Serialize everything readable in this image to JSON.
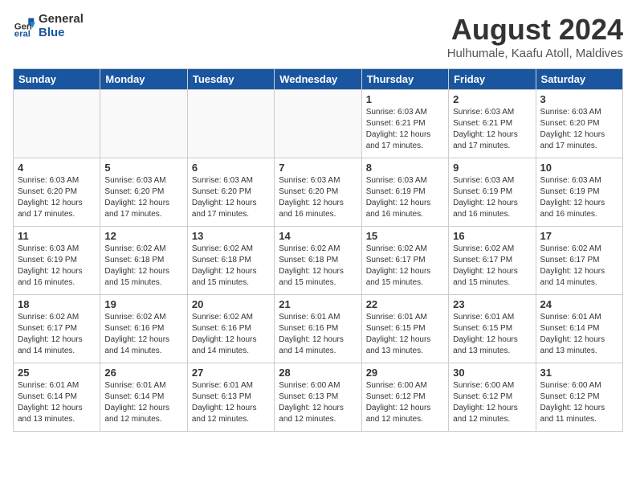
{
  "header": {
    "logo_general": "General",
    "logo_blue": "Blue",
    "month_title": "August 2024",
    "location": "Hulhumale, Kaafu Atoll, Maldives"
  },
  "days_of_week": [
    "Sunday",
    "Monday",
    "Tuesday",
    "Wednesday",
    "Thursday",
    "Friday",
    "Saturday"
  ],
  "weeks": [
    [
      {
        "day": "",
        "info": ""
      },
      {
        "day": "",
        "info": ""
      },
      {
        "day": "",
        "info": ""
      },
      {
        "day": "",
        "info": ""
      },
      {
        "day": "1",
        "info": "Sunrise: 6:03 AM\nSunset: 6:21 PM\nDaylight: 12 hours\nand 17 minutes."
      },
      {
        "day": "2",
        "info": "Sunrise: 6:03 AM\nSunset: 6:21 PM\nDaylight: 12 hours\nand 17 minutes."
      },
      {
        "day": "3",
        "info": "Sunrise: 6:03 AM\nSunset: 6:20 PM\nDaylight: 12 hours\nand 17 minutes."
      }
    ],
    [
      {
        "day": "4",
        "info": "Sunrise: 6:03 AM\nSunset: 6:20 PM\nDaylight: 12 hours\nand 17 minutes."
      },
      {
        "day": "5",
        "info": "Sunrise: 6:03 AM\nSunset: 6:20 PM\nDaylight: 12 hours\nand 17 minutes."
      },
      {
        "day": "6",
        "info": "Sunrise: 6:03 AM\nSunset: 6:20 PM\nDaylight: 12 hours\nand 17 minutes."
      },
      {
        "day": "7",
        "info": "Sunrise: 6:03 AM\nSunset: 6:20 PM\nDaylight: 12 hours\nand 16 minutes."
      },
      {
        "day": "8",
        "info": "Sunrise: 6:03 AM\nSunset: 6:19 PM\nDaylight: 12 hours\nand 16 minutes."
      },
      {
        "day": "9",
        "info": "Sunrise: 6:03 AM\nSunset: 6:19 PM\nDaylight: 12 hours\nand 16 minutes."
      },
      {
        "day": "10",
        "info": "Sunrise: 6:03 AM\nSunset: 6:19 PM\nDaylight: 12 hours\nand 16 minutes."
      }
    ],
    [
      {
        "day": "11",
        "info": "Sunrise: 6:03 AM\nSunset: 6:19 PM\nDaylight: 12 hours\nand 16 minutes."
      },
      {
        "day": "12",
        "info": "Sunrise: 6:02 AM\nSunset: 6:18 PM\nDaylight: 12 hours\nand 15 minutes."
      },
      {
        "day": "13",
        "info": "Sunrise: 6:02 AM\nSunset: 6:18 PM\nDaylight: 12 hours\nand 15 minutes."
      },
      {
        "day": "14",
        "info": "Sunrise: 6:02 AM\nSunset: 6:18 PM\nDaylight: 12 hours\nand 15 minutes."
      },
      {
        "day": "15",
        "info": "Sunrise: 6:02 AM\nSunset: 6:17 PM\nDaylight: 12 hours\nand 15 minutes."
      },
      {
        "day": "16",
        "info": "Sunrise: 6:02 AM\nSunset: 6:17 PM\nDaylight: 12 hours\nand 15 minutes."
      },
      {
        "day": "17",
        "info": "Sunrise: 6:02 AM\nSunset: 6:17 PM\nDaylight: 12 hours\nand 14 minutes."
      }
    ],
    [
      {
        "day": "18",
        "info": "Sunrise: 6:02 AM\nSunset: 6:17 PM\nDaylight: 12 hours\nand 14 minutes."
      },
      {
        "day": "19",
        "info": "Sunrise: 6:02 AM\nSunset: 6:16 PM\nDaylight: 12 hours\nand 14 minutes."
      },
      {
        "day": "20",
        "info": "Sunrise: 6:02 AM\nSunset: 6:16 PM\nDaylight: 12 hours\nand 14 minutes."
      },
      {
        "day": "21",
        "info": "Sunrise: 6:01 AM\nSunset: 6:16 PM\nDaylight: 12 hours\nand 14 minutes."
      },
      {
        "day": "22",
        "info": "Sunrise: 6:01 AM\nSunset: 6:15 PM\nDaylight: 12 hours\nand 13 minutes."
      },
      {
        "day": "23",
        "info": "Sunrise: 6:01 AM\nSunset: 6:15 PM\nDaylight: 12 hours\nand 13 minutes."
      },
      {
        "day": "24",
        "info": "Sunrise: 6:01 AM\nSunset: 6:14 PM\nDaylight: 12 hours\nand 13 minutes."
      }
    ],
    [
      {
        "day": "25",
        "info": "Sunrise: 6:01 AM\nSunset: 6:14 PM\nDaylight: 12 hours\nand 13 minutes."
      },
      {
        "day": "26",
        "info": "Sunrise: 6:01 AM\nSunset: 6:14 PM\nDaylight: 12 hours\nand 12 minutes."
      },
      {
        "day": "27",
        "info": "Sunrise: 6:01 AM\nSunset: 6:13 PM\nDaylight: 12 hours\nand 12 minutes."
      },
      {
        "day": "28",
        "info": "Sunrise: 6:00 AM\nSunset: 6:13 PM\nDaylight: 12 hours\nand 12 minutes."
      },
      {
        "day": "29",
        "info": "Sunrise: 6:00 AM\nSunset: 6:12 PM\nDaylight: 12 hours\nand 12 minutes."
      },
      {
        "day": "30",
        "info": "Sunrise: 6:00 AM\nSunset: 6:12 PM\nDaylight: 12 hours\nand 12 minutes."
      },
      {
        "day": "31",
        "info": "Sunrise: 6:00 AM\nSunset: 6:12 PM\nDaylight: 12 hours\nand 11 minutes."
      }
    ]
  ]
}
